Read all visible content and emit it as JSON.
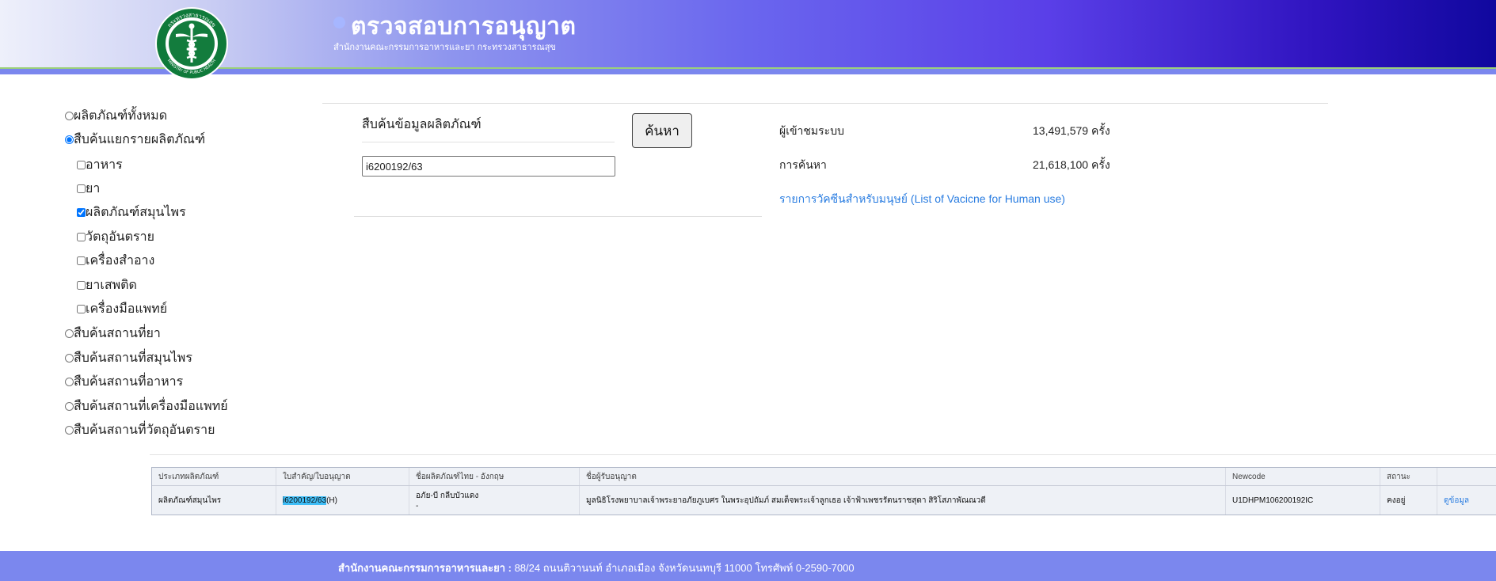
{
  "header": {
    "title": "ตรวจสอบการอนุญาต",
    "subtitle": "สำนักงานคณะกรรมการอาหารและยา กระทรวงสาธารณสุข",
    "logo_top_text": "กระทรวงสาธารณสุข",
    "logo_bottom_text": "MINISTRY OF PUBLIC HEALTH"
  },
  "sidebar": {
    "all_products": "ผลิตภัณฑ์ทั้งหมด",
    "by_product": "สืบค้นแยกรายผลิตภัณฑ์",
    "categories": [
      "อาหาร",
      "ยา",
      "ผลิตภัณฑ์สมุนไพร",
      "วัตถุอันตราย",
      "เครื่องสำอาง",
      "ยาเสพติด",
      "เครื่องมือแพทย์"
    ],
    "places": [
      "สืบค้นสถานที่ยา",
      "สืบค้นสถานที่สมุนไพร",
      "สืบค้นสถานที่อาหาร",
      "สืบค้นสถานที่เครื่องมือแพทย์",
      "สืบค้นสถานที่วัตถุอันตราย"
    ]
  },
  "search": {
    "title": "สืบค้นข้อมูลผลิตภัณฑ์",
    "value": "i6200192/63",
    "button": "ค้นหา"
  },
  "stats": {
    "visitors_label": "ผู้เข้าชมระบบ",
    "visitors_value": "13,491,579 ครั้ง",
    "searches_label": "การค้นหา",
    "searches_value": "21,618,100 ครั้ง",
    "vaccine_link": "รายการวัคซีนสำหรับมนุษย์ (List of Vacicne for Human use)"
  },
  "results": {
    "headers": [
      "ประเภทผลิตภัณฑ์",
      "ใบสำคัญ/ใบอนุญาต",
      "ชื่อผลิตภัณฑ์ไทย - อังกฤษ",
      "ชื่อผู้รับอนุญาต",
      "Newcode",
      "สถานะ",
      ""
    ],
    "row": {
      "type": "ผลิตภัณฑ์สมุนไพร",
      "license_highlight": "i6200192/63",
      "license_suffix": "(H)",
      "name_th": "อภัย-บี กลีบบัวแดง",
      "name_en": "-",
      "licensee": "มูลนิธิโรงพยาบาลเจ้าพระยาอภัยภูเบศร ในพระอุปถัมภ์ สมเด็จพระเจ้าลูกเธอ เจ้าฟ้าเพชรรัตนราชสุดา สิริโสภาพัณณวดี",
      "newcode": "U1DHPM106200192IC",
      "status": "คงอยู่",
      "detail": "ดูข้อมูล"
    }
  },
  "footer": {
    "org": "สำนักงานคณะกรรมการอาหารและยา :",
    "address": " 88/24 ถนนติวานนท์ อำเภอเมือง จังหวัดนนทบุรี 11000 โทรศัพท์ 0-2590-7000"
  }
}
